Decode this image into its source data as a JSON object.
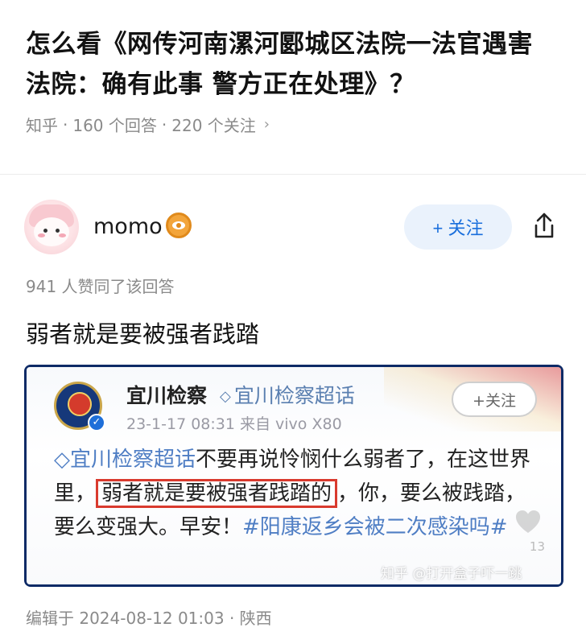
{
  "question": {
    "title": "怎么看《网传河南漯河郾城区法院一法官遇害 法院：确有此事 警方正在处理》？",
    "source": "知乎",
    "answers_count": "160 个回答",
    "followers_count": "220 个关注",
    "chevron_icon": "chevron-right-icon"
  },
  "author": {
    "name": "momo",
    "badge_icon": "eye-badge-icon",
    "follow_label": "+ 关注",
    "share_icon": "share-icon"
  },
  "answer": {
    "likes_text": "941 人赞同了该回答",
    "text": "弱者就是要被强者践踏",
    "edited": "编辑于 2024-08-12 01:03 · 陕西"
  },
  "embedded_post": {
    "account_name": "宜川检察",
    "super_topic": "宜川检察超话",
    "time_source": "23-1-17 08:31  来自 vivo X80",
    "follow_label": "+关注",
    "body_tag": "宜川检察超话",
    "body_part1": "不要再说怜悯什么弱者了，在这世界里，",
    "body_highlight": "弱者就是要被强者践踏的",
    "body_part2": "，你，要么被践踏，要么变强大。早安！",
    "body_hashtag": "#阳康返乡会被二次感染吗#",
    "watermark": "知乎 @打开盒子吓一跳",
    "heart_count": "13"
  }
}
